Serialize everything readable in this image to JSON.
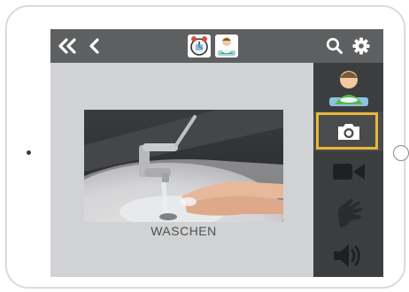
{
  "topbar": {
    "back_all_icon": "double-chevron-left-icon",
    "back_icon": "chevron-left-icon",
    "thumbnails": [
      "clock-picture-icon",
      "washing-boy-picture-icon"
    ],
    "search_icon": "search-icon",
    "settings_icon": "gear-icon"
  },
  "card": {
    "caption": "WASCHEN",
    "image": "hand-washing-photo"
  },
  "sidebar": {
    "items": [
      {
        "icon": "symbol-picture-icon"
      },
      {
        "icon": "camera-icon",
        "selected": true
      },
      {
        "icon": "video-icon"
      },
      {
        "icon": "sign-language-icon"
      },
      {
        "icon": "speaker-icon"
      }
    ]
  },
  "colors": {
    "topbar": "#5e5f60",
    "sidebar": "#3c3d3e",
    "content": "#d1d2d3",
    "highlight": "#e9b73c"
  }
}
